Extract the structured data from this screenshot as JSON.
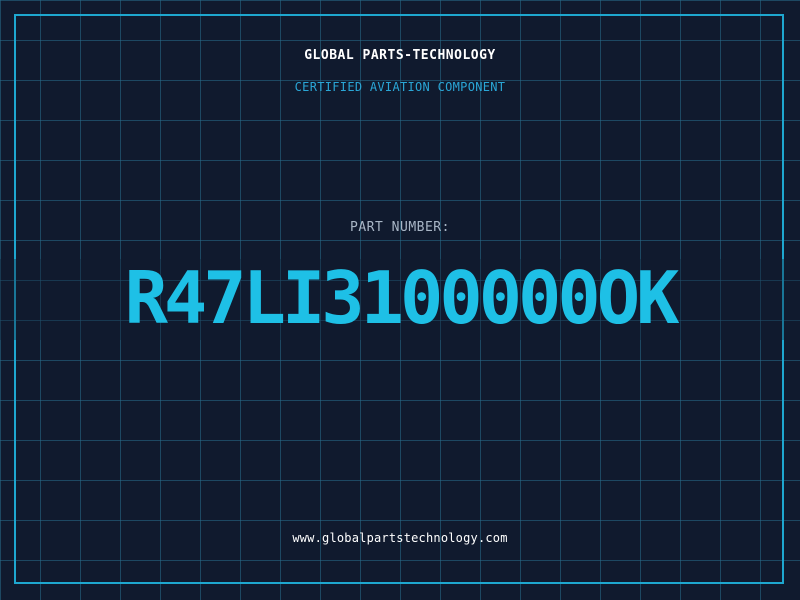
{
  "header": {
    "company": "GLOBAL PARTS-TECHNOLOGY",
    "subtitle": "CERTIFIED AVIATION COMPONENT"
  },
  "part": {
    "label": "PART NUMBER:",
    "number": "R47LI3100000OK"
  },
  "footer": {
    "website": "www.globalpartstechnology.com"
  },
  "colors": {
    "background": "#101a2e",
    "grid": "#286e8c",
    "frame": "#1ea7cf",
    "accent": "#1ec0e6"
  }
}
